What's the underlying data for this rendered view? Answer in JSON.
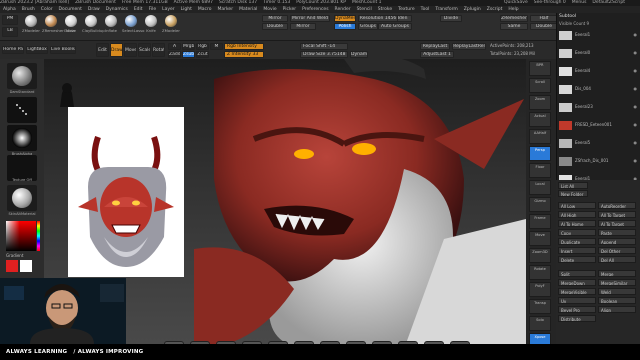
{
  "title_bar": {
    "segments": [
      "ZBrush 2023.2 [Abraham Isell]",
      "ZBrush Document",
      "Free Mem 17.311GB",
      "Active Mem 6897",
      "Scratch Disk 137",
      "Timer 0.153",
      "PolyCount 203.801 KP",
      "MeshCount 1"
    ],
    "right": [
      "QuickSave",
      "See-through 0",
      "Menus",
      "DefaultZScript"
    ]
  },
  "menu_bar": [
    "Alpha",
    "Brush",
    "Color",
    "Document",
    "Draw",
    "Dynamics",
    "Edit",
    "File",
    "Layer",
    "Light",
    "Macro",
    "Marker",
    "Material",
    "Movie",
    "Picker",
    "Preferences",
    "Render",
    "Stencil",
    "Stroke",
    "Texture",
    "Tool",
    "Transform",
    "Zplugin",
    "Zscript",
    "Help"
  ],
  "top_shelf": {
    "tools": [
      "ZModeler",
      "ZRemesherGuide",
      "Move",
      "ClayBuildup",
      "Inflate",
      "SelectLasso",
      "Knife",
      "ZModeler"
    ],
    "tool_colors": [
      "#b8b8b8",
      "#c08850",
      "#d0d0d0",
      "#c8c8c8",
      "#bbbbbb",
      "#7aa0d0",
      "#c0c0c0",
      "#c8a060"
    ],
    "mirror_buttons": [
      "Mirror",
      "Mirror And Weld",
      "Double",
      "Mirror",
      "Del Hidden",
      "Auto Groups"
    ],
    "dynamesh": [
      "DynaMesh",
      "Resolution 1456",
      "Polish",
      "Groups",
      "Divide"
    ],
    "zremesher": [
      "ZRemesher",
      "Half",
      "Same",
      "Double"
    ]
  },
  "draw_shelf": {
    "mode_buttons": [
      "Edit",
      "Draw",
      "Move",
      "Scale",
      "Rotate"
    ],
    "rgb_row": [
      "A",
      "Mrgb",
      "Rgb",
      "M",
      "Zadd",
      "Zsub",
      "Zcut"
    ],
    "rgb_intensity": "Rgb Intensity",
    "z_intensity": "Z Intensity 33",
    "focal_shift": "Focal Shift -14",
    "draw_size": "Draw Size 3.75148",
    "dynamic": "Dynamic",
    "replay": [
      "ReplayLast",
      "ReplayLastRel"
    ],
    "active_points": "ActivePoints: 208,213",
    "total_points": "TotalPoints: 23,208 Mil",
    "adjust_last": "AdjustLast 1"
  },
  "left_shelf": {
    "brushes": [
      "DamStandard",
      "BrushAlpha",
      "Texture Off",
      "SkinAltMaterial"
    ],
    "gradient": "Gradient",
    "swatch_colors": [
      "#e02020",
      "#20c0e0",
      "#ffffff",
      "#000000"
    ]
  },
  "subtool": {
    "header": "Subtool",
    "visible": "Visible Count 9",
    "items": [
      "Eeeral1",
      "Eeeral0",
      "Eeeral4",
      "Dis_004",
      "Eeeral23",
      "FRESD_Eeteen001",
      "Eeeral5",
      "ZSfrach_Dis_001",
      "Eeeral1"
    ],
    "thumb_colors": [
      "#cfcfcf",
      "#d0d0d0",
      "#e0e0e0",
      "#d8d8d8",
      "#cccccc",
      "#c0392b",
      "#b8b8b8",
      "#8a8a8a",
      "#e3e3e3"
    ]
  },
  "subtool_buttons": {
    "list_all": "List All",
    "new_folder": "New Folder",
    "rows": [
      [
        "All Low",
        "AutoReorder"
      ],
      [
        "All High",
        "All To Target"
      ],
      [
        "Al To Home",
        "Al To Target"
      ],
      [
        "Copy",
        "Paste"
      ],
      [
        "Duplicate",
        "Append"
      ],
      [
        "Insert",
        "Del Other"
      ],
      [
        "Delete",
        "Del All"
      ]
    ],
    "split_merge": [
      "Split",
      "Merge",
      "MergeDown",
      "MergeSimilar",
      "MergeVisible",
      "Weld",
      "Uv",
      "Boolean",
      "Bevel Pro",
      "Align",
      "Distribute"
    ]
  },
  "right_dock": [
    "BPR",
    "Scroll",
    "Zoom",
    "Actual",
    "AAHalf",
    "Persp",
    "Floor",
    "Local",
    "Gizmo",
    "Frame",
    "Move",
    "Zoom3D",
    "Rotate",
    "PolyF",
    "Transp",
    "Solo",
    "Xpose"
  ],
  "bottom_bar": {
    "left_text": "ALWAYS LEARNING",
    "right_text": "/ ALWAYS IMPROVING"
  },
  "colors": {
    "accent_orange": "#d88a1e",
    "accent_blue": "#2a7ad8",
    "skin": "#8a2a22",
    "beard": "#d8d8d8"
  }
}
